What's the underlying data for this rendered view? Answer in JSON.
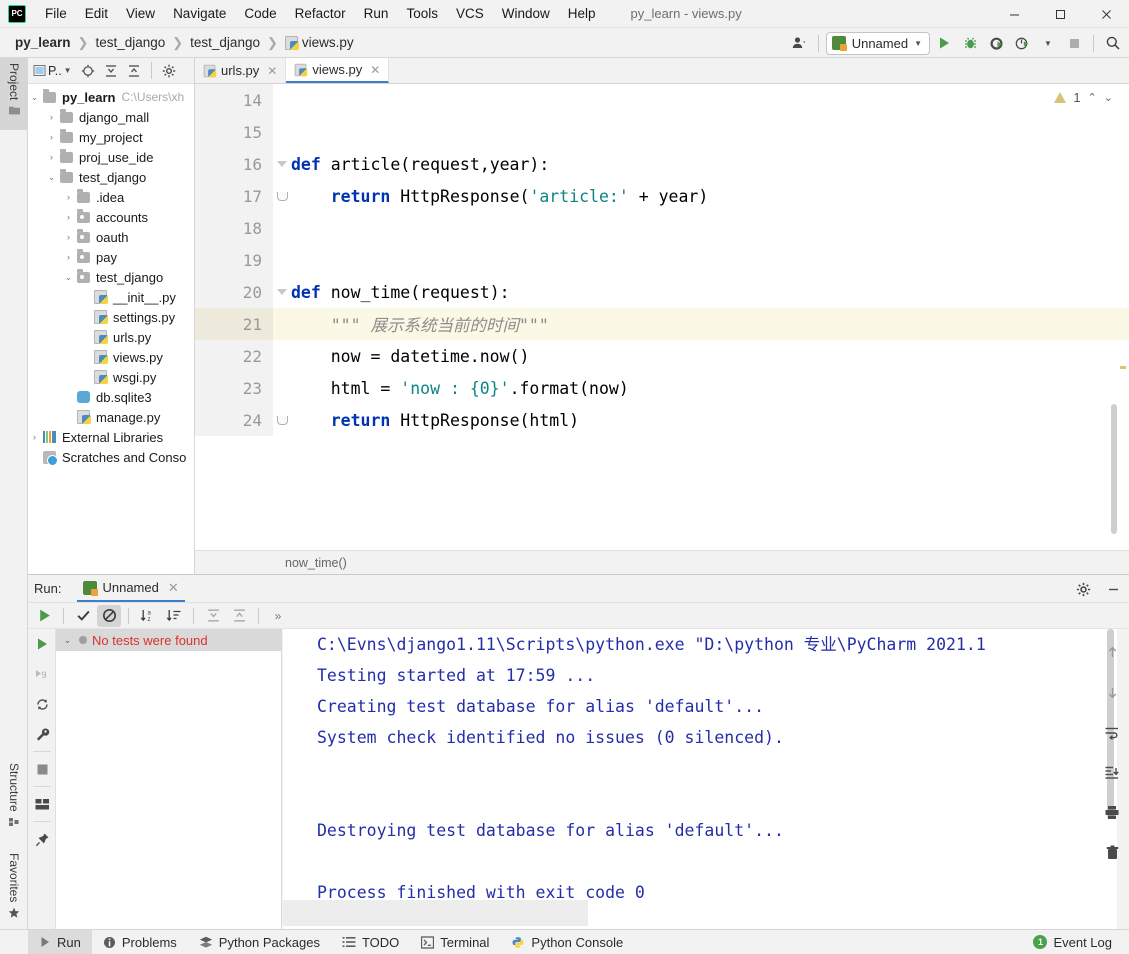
{
  "window": {
    "title": "py_learn - views.py",
    "app_icon": "pycharm-logo",
    "controls": {
      "minimize": "—",
      "maximize": "☐",
      "close": "✕"
    }
  },
  "menu": [
    {
      "label": "File"
    },
    {
      "label": "Edit"
    },
    {
      "label": "View"
    },
    {
      "label": "Navigate"
    },
    {
      "label": "Code"
    },
    {
      "label": "Refactor"
    },
    {
      "label": "Run"
    },
    {
      "label": "Tools"
    },
    {
      "label": "VCS"
    },
    {
      "label": "Window"
    },
    {
      "label": "Help"
    }
  ],
  "breadcrumbs": [
    {
      "label": "py_learn",
      "bold": true,
      "icon": null
    },
    {
      "label": "test_django",
      "bold": false,
      "icon": null
    },
    {
      "label": "test_django",
      "bold": false,
      "icon": null
    },
    {
      "label": "views.py",
      "bold": false,
      "icon": "python-file-icon"
    }
  ],
  "toolbar": {
    "account_icon": "user-icon",
    "run_config": "Unnamed",
    "run_button": "run-icon",
    "debug_button": "debug-icon",
    "run_coverage_button": "run-with-coverage-icon",
    "profile_button": "profile-icon",
    "stop_button": "stop-icon",
    "search_button": "search-icon"
  },
  "left_stripe": [
    {
      "label": "Project",
      "icon": "project-folder-icon",
      "active": true
    },
    {
      "label": "Structure",
      "icon": "structure-icon",
      "active": false
    },
    {
      "label": "Favorites",
      "icon": "star-icon",
      "active": false
    }
  ],
  "sidebar": {
    "title": "P..",
    "toolbar_icons": [
      "project-select-icon",
      "locate-icon",
      "expand-all-icon",
      "collapse-all-icon",
      "settings-gear-icon"
    ],
    "tree": [
      {
        "indent": 0,
        "arrow": "down",
        "icon": "folder-icon",
        "label": "py_learn",
        "bold": true,
        "path": "C:\\Users\\xh"
      },
      {
        "indent": 1,
        "arrow": "right",
        "icon": "folder-icon",
        "label": "django_mall",
        "bold": false,
        "path": ""
      },
      {
        "indent": 1,
        "arrow": "right",
        "icon": "folder-icon",
        "label": "my_project",
        "bold": false,
        "path": ""
      },
      {
        "indent": 1,
        "arrow": "right",
        "icon": "folder-icon",
        "label": "proj_use_ide",
        "bold": false,
        "path": ""
      },
      {
        "indent": 1,
        "arrow": "down",
        "icon": "folder-icon",
        "label": "test_django",
        "bold": false,
        "path": ""
      },
      {
        "indent": 2,
        "arrow": "right",
        "icon": "folder-icon",
        "label": ".idea",
        "bold": false,
        "path": ""
      },
      {
        "indent": 2,
        "arrow": "right",
        "icon": "source-folder-icon",
        "label": "accounts",
        "bold": false,
        "path": ""
      },
      {
        "indent": 2,
        "arrow": "right",
        "icon": "source-folder-icon",
        "label": "oauth",
        "bold": false,
        "path": ""
      },
      {
        "indent": 2,
        "arrow": "right",
        "icon": "source-folder-icon",
        "label": "pay",
        "bold": false,
        "path": ""
      },
      {
        "indent": 2,
        "arrow": "down",
        "icon": "source-folder-icon",
        "label": "test_django",
        "bold": false,
        "path": ""
      },
      {
        "indent": 3,
        "arrow": "none",
        "icon": "python-file-icon",
        "label": "__init__.py",
        "bold": false,
        "path": ""
      },
      {
        "indent": 3,
        "arrow": "none",
        "icon": "python-file-icon",
        "label": "settings.py",
        "bold": false,
        "path": ""
      },
      {
        "indent": 3,
        "arrow": "none",
        "icon": "python-file-icon",
        "label": "urls.py",
        "bold": false,
        "path": ""
      },
      {
        "indent": 3,
        "arrow": "none",
        "icon": "python-file-icon",
        "label": "views.py",
        "bold": false,
        "path": ""
      },
      {
        "indent": 3,
        "arrow": "none",
        "icon": "python-file-icon",
        "label": "wsgi.py",
        "bold": false,
        "path": ""
      },
      {
        "indent": 2,
        "arrow": "none",
        "icon": "database-icon",
        "label": "db.sqlite3",
        "bold": false,
        "path": ""
      },
      {
        "indent": 2,
        "arrow": "none",
        "icon": "python-file-icon",
        "label": "manage.py",
        "bold": false,
        "path": ""
      },
      {
        "indent": 0,
        "arrow": "right",
        "icon": "libraries-icon",
        "label": "External Libraries",
        "bold": false,
        "path": ""
      },
      {
        "indent": 0,
        "arrow": "none",
        "icon": "scratches-icon",
        "label": "Scratches and Conso",
        "bold": false,
        "path": ""
      }
    ]
  },
  "editor": {
    "tabs": [
      {
        "label": "urls.py",
        "icon": "python-file-icon",
        "active": false,
        "close": "✕"
      },
      {
        "label": "views.py",
        "icon": "python-file-icon",
        "active": true,
        "close": "✕"
      }
    ],
    "inspection": {
      "warning_count": "1",
      "warning_icon": "warning-triangle-icon",
      "up": "⌃",
      "down": "⌄"
    },
    "breadcrumb": "now_time()",
    "lines": [
      {
        "num": "14",
        "fold": "none",
        "highlight": false,
        "tokens": []
      },
      {
        "num": "15",
        "fold": "none",
        "highlight": false,
        "tokens": []
      },
      {
        "num": "16",
        "fold": "tri",
        "highlight": false,
        "tokens": [
          {
            "t": "def ",
            "c": "kw"
          },
          {
            "t": "article(request,year):",
            "c": "def"
          }
        ]
      },
      {
        "num": "17",
        "fold": "arc",
        "highlight": false,
        "tokens": [
          {
            "t": "    ",
            "c": "def"
          },
          {
            "t": "return",
            "c": "kw"
          },
          {
            "t": " HttpResponse(",
            "c": "def"
          },
          {
            "t": "'article:'",
            "c": "strteal"
          },
          {
            "t": " + year)",
            "c": "def"
          }
        ]
      },
      {
        "num": "18",
        "fold": "none",
        "highlight": false,
        "tokens": []
      },
      {
        "num": "19",
        "fold": "none",
        "highlight": false,
        "tokens": []
      },
      {
        "num": "20",
        "fold": "tri",
        "highlight": false,
        "tokens": [
          {
            "t": "def ",
            "c": "kw"
          },
          {
            "t": "now_time(request):",
            "c": "def"
          }
        ]
      },
      {
        "num": "21",
        "fold": "none",
        "highlight": true,
        "tokens": [
          {
            "t": "    \"\"\" 展示系统当前的时间\"\"\"",
            "c": "cmt"
          }
        ]
      },
      {
        "num": "22",
        "fold": "none",
        "highlight": false,
        "tokens": [
          {
            "t": "    now = datetime.now()",
            "c": "def"
          }
        ]
      },
      {
        "num": "23",
        "fold": "none",
        "highlight": false,
        "tokens": [
          {
            "t": "    html = ",
            "c": "def"
          },
          {
            "t": "'now : {0}'",
            "c": "strteal"
          },
          {
            "t": ".format(now)",
            "c": "def"
          }
        ]
      },
      {
        "num": "24",
        "fold": "arc",
        "highlight": false,
        "tokens": [
          {
            "t": "    ",
            "c": "def"
          },
          {
            "t": "return",
            "c": "kw"
          },
          {
            "t": " HttpResponse(html)",
            "c": "def"
          }
        ]
      }
    ]
  },
  "run_panel": {
    "label": "Run:",
    "tab": {
      "label": "Unnamed",
      "icon": "django-run-icon",
      "close": "✕"
    },
    "header_buttons": [
      "settings-gear-icon",
      "hide-icon"
    ],
    "toolbar": [
      {
        "icon": "rerun-icon",
        "name": "rerun-button",
        "pressed": false
      },
      {
        "icon": "check-icon",
        "name": "show-passed-button",
        "pressed": false
      },
      {
        "icon": "ignored-icon",
        "name": "show-ignored-button",
        "pressed": true
      },
      {
        "icon": "sort-alpha-icon",
        "name": "sort-alphabetically-button",
        "pressed": false
      },
      {
        "icon": "sort-duration-icon",
        "name": "sort-by-duration-button",
        "pressed": false
      },
      {
        "icon": "expand-all-icon",
        "name": "expand-all-button",
        "pressed": false
      },
      {
        "icon": "collapse-all-icon",
        "name": "collapse-all-button",
        "pressed": false
      },
      {
        "icon": "more-icon",
        "name": "more-options-button",
        "pressed": false
      }
    ],
    "side_buttons": [
      "rerun-icon",
      "rerun-failed-icon",
      "rerun-auto-icon",
      "wrench-icon",
      "stop-icon",
      "layout-icon",
      "pin-icon"
    ],
    "right_buttons": [
      "scroll-up-icon",
      "scroll-down-icon",
      "soft-wrap-icon",
      "scroll-to-end-icon",
      "print-icon",
      "clear-all-icon"
    ],
    "test_tree": {
      "status": "No tests were found",
      "arrow": "⌄"
    },
    "console": [
      "C:\\Evns\\django1.11\\Scripts\\python.exe \"D:\\python 专业\\PyCharm 2021.1",
      "Testing started at 17:59 ...",
      "Creating test database for alias 'default'...",
      "System check identified no issues (0 silenced).",
      "",
      "",
      "Destroying test database for alias 'default'...",
      "",
      "Process finished with exit code 0"
    ]
  },
  "status_bar": {
    "items": [
      {
        "label": "Run",
        "icon": "run-icon",
        "active": true
      },
      {
        "label": "Problems",
        "icon": "problems-icon",
        "active": false
      },
      {
        "label": "Python Packages",
        "icon": "packages-icon",
        "active": false
      },
      {
        "label": "TODO",
        "icon": "todo-icon",
        "active": false
      },
      {
        "label": "Terminal",
        "icon": "terminal-icon",
        "active": false
      },
      {
        "label": "Python Console",
        "icon": "python-console-icon",
        "active": false
      }
    ],
    "event_log": {
      "label": "Event Log",
      "count": "1"
    }
  },
  "colors": {
    "accent": "#3c7ecc",
    "keyword": "#0033b3",
    "string": "#0b8484",
    "comment": "#8c8c8c",
    "console_text": "#232ea8",
    "error": "#d8332f",
    "chrome": "#f2f2f2"
  }
}
